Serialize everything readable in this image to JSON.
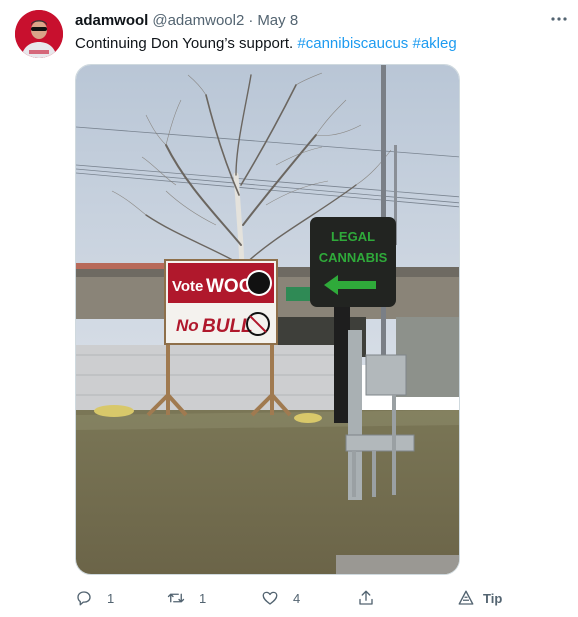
{
  "tweet": {
    "display_name": "adamwool",
    "handle": "@adamwool2",
    "separator": "·",
    "date": "May 8",
    "text_plain": "Continuing Don Young’s support. ",
    "hashtags": [
      "#cannibiscaucus",
      "#akleg"
    ]
  },
  "photo": {
    "sign_vote": "Vote",
    "sign_name": "WOOL",
    "sign_no": "No",
    "sign_bull": "BULL",
    "sign_legal": "LEGAL",
    "sign_cannabis": "CANNABIS"
  },
  "actions": {
    "reply_count": "1",
    "retweet_count": "1",
    "like_count": "4",
    "tip_label": "Tip"
  },
  "icons": {
    "more": "more-horizontal-icon",
    "reply": "reply-icon",
    "retweet": "retweet-icon",
    "like": "heart-icon",
    "share": "share-icon",
    "tip": "tip-icon"
  },
  "colors": {
    "link": "#1d9bf0",
    "secondary_text": "#536471",
    "sign_red": "#b0182c",
    "sign_green": "#2faa3a"
  }
}
